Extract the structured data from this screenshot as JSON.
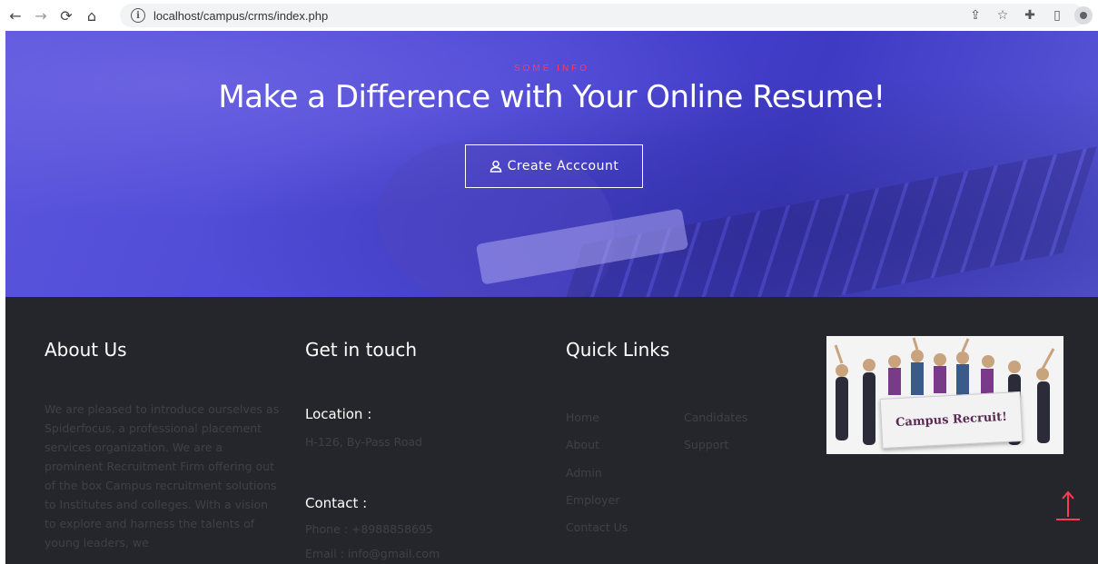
{
  "browser": {
    "url": "localhost/campus/crms/index.php",
    "nav_icons": [
      "back-arrow-icon",
      "forward-arrow-icon",
      "reload-icon",
      "home-icon"
    ],
    "right_icons": [
      "share-icon",
      "star-icon",
      "extensions-icon",
      "sidebar-icon",
      "profile-avatar"
    ]
  },
  "hero": {
    "subtitle": "SOME INFO",
    "title": "Make a Difference with Your Online Resume!",
    "button_label": "Create Acccount"
  },
  "footer": {
    "about": {
      "heading": "About Us",
      "text": "We are pleased to introduce ourselves as Spiderfocus, a professional placement services organization. We are a prominent Recruitment Firm offering out of the box Campus recruitment solutions to Institutes and colleges. With a vision to explore and harness the talents of young leaders, we"
    },
    "touch": {
      "heading": "Get in touch",
      "location_label": "Location :",
      "location_value": "H-126, By-Pass Road",
      "contact_label": "Contact :",
      "phone": "Phone : +8988858695",
      "email": "Email : info@gmail.com"
    },
    "links": {
      "heading": "Quick Links",
      "col1": [
        "Home",
        "About",
        "Admin",
        "Employer",
        "Contact Us"
      ],
      "col2": [
        "Candidates",
        "Support"
      ]
    },
    "promo": {
      "banner_text": "Campus Recruit!"
    }
  },
  "colors": {
    "hero_blue": "#4b46d4",
    "accent_red": "#ff3b54",
    "footer_bg": "#24262b"
  }
}
